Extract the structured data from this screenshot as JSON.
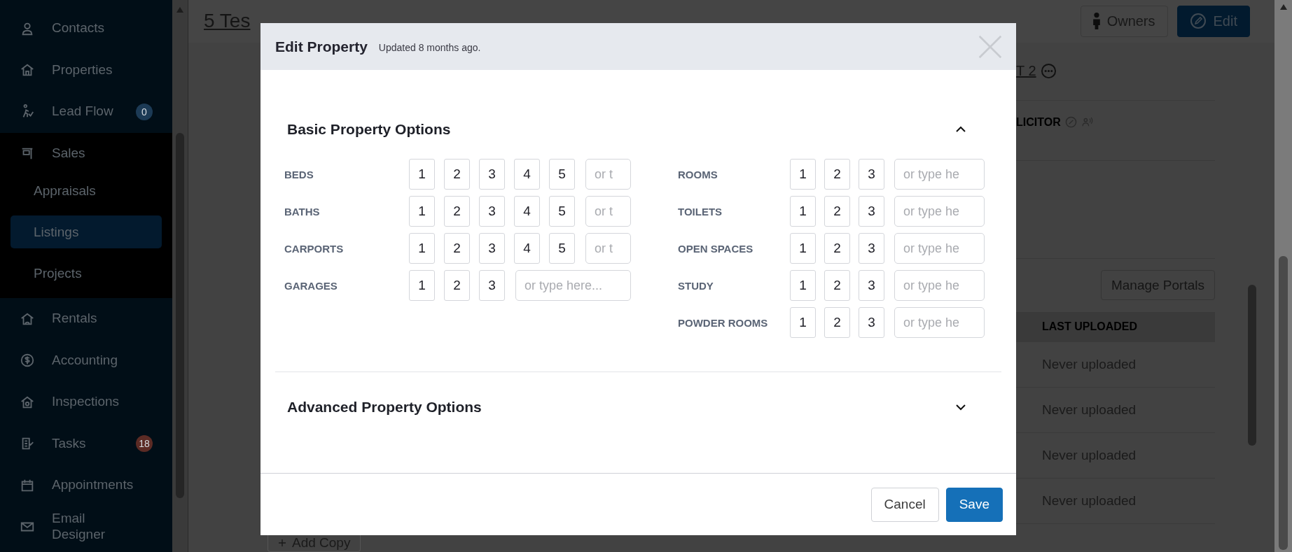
{
  "sidebar": {
    "items": [
      {
        "label": "Contacts",
        "expanded": false
      },
      {
        "label": "Properties",
        "expanded": false
      },
      {
        "label": "Lead Flow",
        "expanded": false,
        "badge": {
          "text": "0",
          "color": "#1c3a55"
        }
      },
      {
        "label": "Sales",
        "expanded": true,
        "children": [
          {
            "label": "Appraisals",
            "selected": false
          },
          {
            "label": "Listings",
            "selected": true
          },
          {
            "label": "Projects",
            "selected": false
          }
        ]
      },
      {
        "label": "Rentals",
        "expanded": false
      },
      {
        "label": "Accounting",
        "expanded": false
      },
      {
        "label": "Inspections",
        "expanded": false
      },
      {
        "label": "Tasks",
        "expanded": false,
        "badge": {
          "text": "18",
          "color": "#5b2b25"
        }
      },
      {
        "label": "Appointments",
        "expanded": false
      },
      {
        "label": "Email Designer",
        "expanded": false
      }
    ]
  },
  "page": {
    "title": "5 Tes",
    "header_buttons": [
      {
        "label": "Owners",
        "kind": "secondary"
      },
      {
        "label": "Edit",
        "kind": "primary"
      }
    ],
    "contact_name": "T 2",
    "role_label": "LICITOR",
    "manage_button": "Manage Portals",
    "table": {
      "columns": [
        "LAST UPLOADED"
      ],
      "rows": [
        [
          "Never uploaded"
        ],
        [
          "Never uploaded"
        ],
        [
          "Never uploaded"
        ],
        [
          "Never uploaded"
        ]
      ]
    },
    "add_button": "Add Copy"
  },
  "modal": {
    "title": "Edit Property",
    "subtitle": "Updated 8 months ago.",
    "sections": [
      {
        "title": "Basic Property Options",
        "expanded": true,
        "columns": [
          [
            {
              "label": "BEDS",
              "options": [
                {
                  "label": "1",
                  "selected": false
                },
                {
                  "label": "2",
                  "selected": false
                },
                {
                  "label": "3",
                  "selected": false
                },
                {
                  "label": "4",
                  "selected": false
                },
                {
                  "label": "5",
                  "selected": false
                }
              ],
              "placeholder": "or t"
            },
            {
              "label": "BATHS",
              "options": [
                {
                  "label": "1",
                  "selected": false
                },
                {
                  "label": "2",
                  "selected": false
                },
                {
                  "label": "3",
                  "selected": false
                },
                {
                  "label": "4",
                  "selected": false
                },
                {
                  "label": "5",
                  "selected": false
                }
              ],
              "placeholder": "or t"
            },
            {
              "label": "CARPORTS",
              "options": [
                {
                  "label": "1",
                  "selected": false
                },
                {
                  "label": "2",
                  "selected": false
                },
                {
                  "label": "3",
                  "selected": false
                },
                {
                  "label": "4",
                  "selected": false
                },
                {
                  "label": "5",
                  "selected": false
                }
              ],
              "placeholder": "or t"
            },
            {
              "label": "GARAGES",
              "options": [
                {
                  "label": "1",
                  "selected": false
                },
                {
                  "label": "2",
                  "selected": false
                },
                {
                  "label": "3",
                  "selected": false
                }
              ],
              "placeholder": "or type here..."
            }
          ],
          [
            {
              "label": "ROOMS",
              "options": [
                {
                  "label": "1",
                  "selected": false
                },
                {
                  "label": "2",
                  "selected": false
                },
                {
                  "label": "3",
                  "selected": false
                }
              ],
              "placeholder": "or type he"
            },
            {
              "label": "TOILETS",
              "options": [
                {
                  "label": "1",
                  "selected": false
                },
                {
                  "label": "2",
                  "selected": false
                },
                {
                  "label": "3",
                  "selected": false
                }
              ],
              "placeholder": "or type he"
            },
            {
              "label": "OPEN SPACES",
              "options": [
                {
                  "label": "1",
                  "selected": false
                },
                {
                  "label": "2",
                  "selected": false
                },
                {
                  "label": "3",
                  "selected": false
                }
              ],
              "placeholder": "or type he"
            },
            {
              "label": "STUDY",
              "options": [
                {
                  "label": "1",
                  "selected": false
                },
                {
                  "label": "2",
                  "selected": false
                },
                {
                  "label": "3",
                  "selected": false
                }
              ],
              "placeholder": "or type he"
            },
            {
              "label": "POWDER ROOMS",
              "options": [
                {
                  "label": "1",
                  "selected": false
                },
                {
                  "label": "2",
                  "selected": false
                },
                {
                  "label": "3",
                  "selected": false
                }
              ],
              "placeholder": "or type he"
            }
          ]
        ]
      },
      {
        "title": "Advanced Property Options",
        "expanded": false
      }
    ],
    "buttons": [
      {
        "label": "Cancel",
        "kind": "secondary"
      },
      {
        "label": "Save",
        "kind": "primary"
      }
    ]
  }
}
